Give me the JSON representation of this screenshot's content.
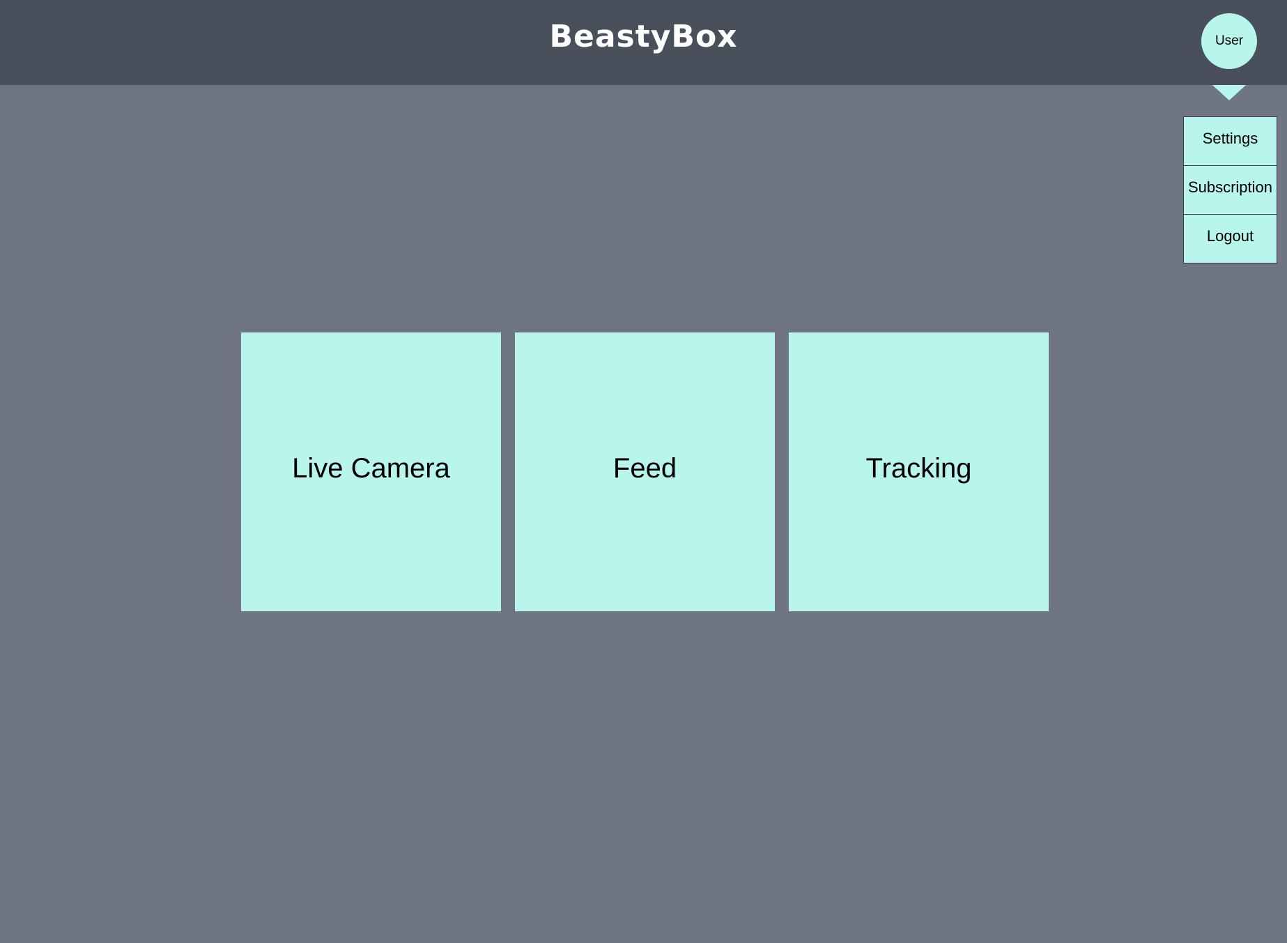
{
  "header": {
    "title": "BeastyBox",
    "user_label": "User"
  },
  "user_menu": {
    "items": [
      {
        "label": "Settings"
      },
      {
        "label": "Subscription"
      },
      {
        "label": "Logout"
      }
    ]
  },
  "tiles": [
    {
      "label": "Live Camera"
    },
    {
      "label": "Feed"
    },
    {
      "label": "Tracking"
    }
  ],
  "colors": {
    "header_bg": "#4a505b",
    "page_bg": "#6f7582",
    "accent": "#b8f5ec",
    "title_text": "#ffffff"
  }
}
